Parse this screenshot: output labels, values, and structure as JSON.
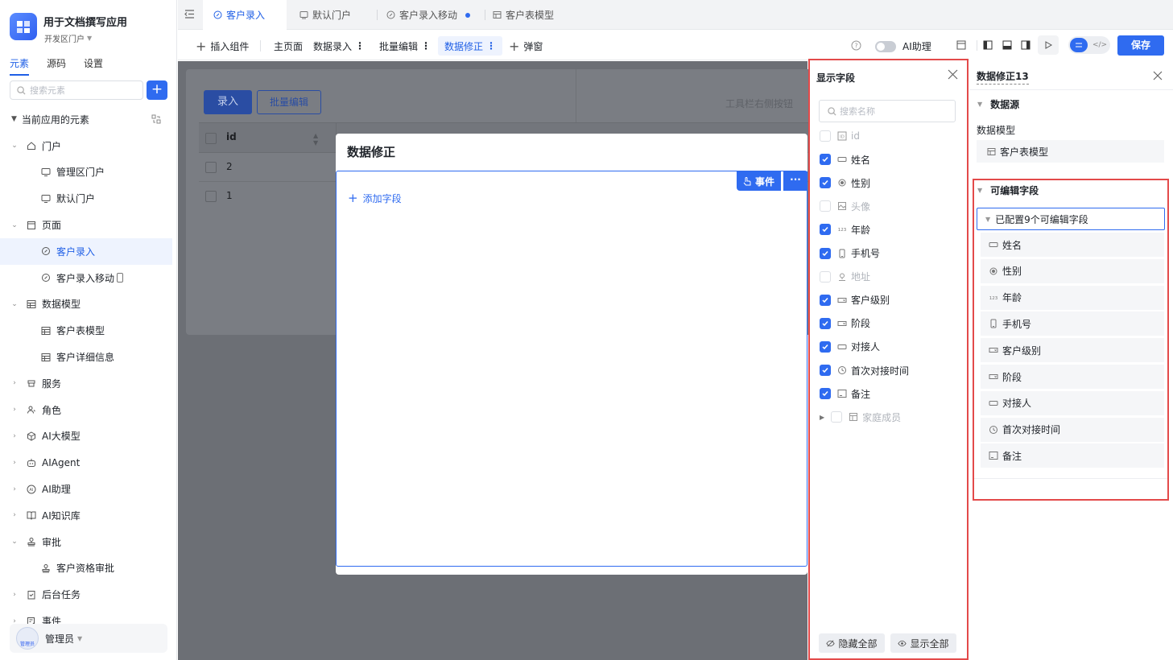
{
  "app": {
    "title": "用于文档撰写应用",
    "portal": "开发区门户"
  },
  "sidebar": {
    "tabs": [
      "元素",
      "源码",
      "设置"
    ],
    "search_placeholder": "搜索元素",
    "section_title": "当前应用的元素",
    "items": [
      {
        "label": "门户",
        "level": 0,
        "expanded": true,
        "icon": "home-icon"
      },
      {
        "label": "管理区门户",
        "level": 1,
        "icon": "portal-icon"
      },
      {
        "label": "默认门户",
        "level": 1,
        "icon": "portal-icon"
      },
      {
        "label": "页面",
        "level": 0,
        "expanded": true,
        "icon": "page-icon"
      },
      {
        "label": "客户录入",
        "level": 1,
        "icon": "form-icon",
        "selected": true
      },
      {
        "label": "客户录入移动",
        "level": 1,
        "icon": "form-icon",
        "mobile": true
      },
      {
        "label": "数据模型",
        "level": 0,
        "expanded": true,
        "icon": "table-icon"
      },
      {
        "label": "客户表模型",
        "level": 1,
        "icon": "table-icon"
      },
      {
        "label": "客户详细信息",
        "level": 1,
        "icon": "table-icon"
      },
      {
        "label": "服务",
        "level": 0,
        "expanded": false,
        "icon": "service-icon"
      },
      {
        "label": "角色",
        "level": 0,
        "expanded": false,
        "icon": "role-icon"
      },
      {
        "label": "AI大模型",
        "level": 0,
        "expanded": false,
        "icon": "cube-icon"
      },
      {
        "label": "AIAgent",
        "level": 0,
        "expanded": false,
        "icon": "robot-icon"
      },
      {
        "label": "AI助理",
        "level": 0,
        "expanded": false,
        "icon": "ai-icon"
      },
      {
        "label": "AI知识库",
        "level": 0,
        "expanded": false,
        "icon": "book-icon"
      },
      {
        "label": "审批",
        "level": 0,
        "expanded": true,
        "icon": "stamp-icon"
      },
      {
        "label": "客户资格审批",
        "level": 1,
        "icon": "stamp-icon"
      },
      {
        "label": "后台任务",
        "level": 0,
        "expanded": false,
        "icon": "task-icon"
      },
      {
        "label": "事件",
        "level": 0,
        "expanded": false,
        "icon": "event-icon"
      }
    ],
    "admin": {
      "name": "管理员",
      "avatar_text": "管理员"
    }
  },
  "tabs": [
    {
      "label": "客户录入",
      "active": true
    },
    {
      "label": "默认门户"
    },
    {
      "label": "客户录入移动",
      "dot": true
    },
    {
      "label": "客户表模型"
    }
  ],
  "toolbar": {
    "insert": "插入组件",
    "main_page": "主页面",
    "data_entry": "数据录入",
    "batch_edit": "批量编辑",
    "data_fix": "数据修正",
    "popup": "弹窗",
    "ai_assistant": "AI助理",
    "save": "保存"
  },
  "canvas": {
    "entry_button": "录入",
    "batch_button": "批量编辑",
    "toolbar_right_hint": "工具栏右侧按钮",
    "table": {
      "header": "id",
      "rows": [
        "2",
        "1"
      ]
    },
    "dialog": {
      "title": "数据修正",
      "add_field": "添加字段",
      "event_button": "事件"
    }
  },
  "fields_panel": {
    "title": "显示字段",
    "search_placeholder": "搜索名称",
    "fields": [
      {
        "label": "id",
        "checked": false,
        "disabled": true,
        "icon": "id-icon"
      },
      {
        "label": "姓名",
        "checked": true,
        "icon": "text-field-icon"
      },
      {
        "label": "性别",
        "checked": true,
        "icon": "radio-icon"
      },
      {
        "label": "头像",
        "checked": false,
        "disabled": true,
        "icon": "image-icon"
      },
      {
        "label": "年龄",
        "checked": true,
        "icon": "number-icon"
      },
      {
        "label": "手机号",
        "checked": true,
        "icon": "phone-icon"
      },
      {
        "label": "地址",
        "checked": false,
        "disabled": true,
        "icon": "location-icon"
      },
      {
        "label": "客户级别",
        "checked": true,
        "icon": "select-icon"
      },
      {
        "label": "阶段",
        "checked": true,
        "icon": "select-icon"
      },
      {
        "label": "对接人",
        "checked": true,
        "icon": "text-field-icon"
      },
      {
        "label": "首次对接时间",
        "checked": true,
        "icon": "clock-icon"
      },
      {
        "label": "备注",
        "checked": true,
        "icon": "textarea-icon"
      },
      {
        "label": "家庭成员",
        "checked": false,
        "disabled": true,
        "icon": "subtable-icon",
        "expandable": true
      }
    ],
    "hide_all": "隐藏全部",
    "show_all": "显示全部"
  },
  "right_panel": {
    "title": "数据修正13",
    "datasource_section": "数据源",
    "data_model_label": "数据模型",
    "data_model_value": "客户表模型",
    "editable_section": "可编辑字段",
    "configured_label": "已配置9个可编辑字段",
    "editable_fields": [
      {
        "label": "姓名",
        "icon": "text-field-icon"
      },
      {
        "label": "性别",
        "icon": "radio-icon"
      },
      {
        "label": "年龄",
        "icon": "number-icon"
      },
      {
        "label": "手机号",
        "icon": "phone-icon"
      },
      {
        "label": "客户级别",
        "icon": "select-icon"
      },
      {
        "label": "阶段",
        "icon": "select-icon"
      },
      {
        "label": "对接人",
        "icon": "text-field-icon"
      },
      {
        "label": "首次对接时间",
        "icon": "clock-icon"
      },
      {
        "label": "备注",
        "icon": "textarea-icon"
      }
    ]
  },
  "colors": {
    "primary": "#2f6bf0",
    "highlight_border": "#e34a4a",
    "overlay": "#6c6f75"
  }
}
